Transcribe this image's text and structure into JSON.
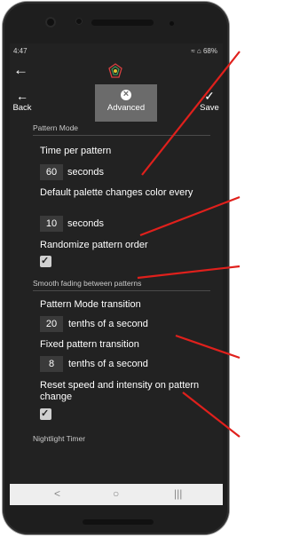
{
  "status": {
    "time": "4:47",
    "indicators": "≈ ⌂ 68%"
  },
  "appbar": {
    "back_icon": "arrow-left-icon",
    "logo_icon": "app-logo-icon"
  },
  "toolbar": {
    "back_label": "Back",
    "advanced_label": "Advanced",
    "save_label": "Save"
  },
  "sections": {
    "pattern_mode": "Pattern Mode",
    "smooth_fading": "Smooth fading between patterns",
    "nightlight": "Nightlight Timer"
  },
  "settings": {
    "time_per_pattern": {
      "label": "Time per pattern",
      "value": "60",
      "unit": "seconds"
    },
    "palette_change": {
      "label": "Default palette changes color every",
      "value": "10",
      "unit": "seconds"
    },
    "randomize": {
      "label": "Randomize pattern order",
      "checked": true
    },
    "pattern_transition": {
      "label": "Pattern Mode transition",
      "value": "20",
      "unit": "tenths of a second"
    },
    "fixed_transition": {
      "label": "Fixed pattern transition",
      "value": "8",
      "unit": "tenths of a second"
    },
    "reset_speed": {
      "label": "Reset speed and intensity on pattern change",
      "checked": true
    }
  },
  "navbar": {
    "back": "<",
    "home": "○",
    "recents": "|||"
  },
  "annotation_color": "#e0201c"
}
